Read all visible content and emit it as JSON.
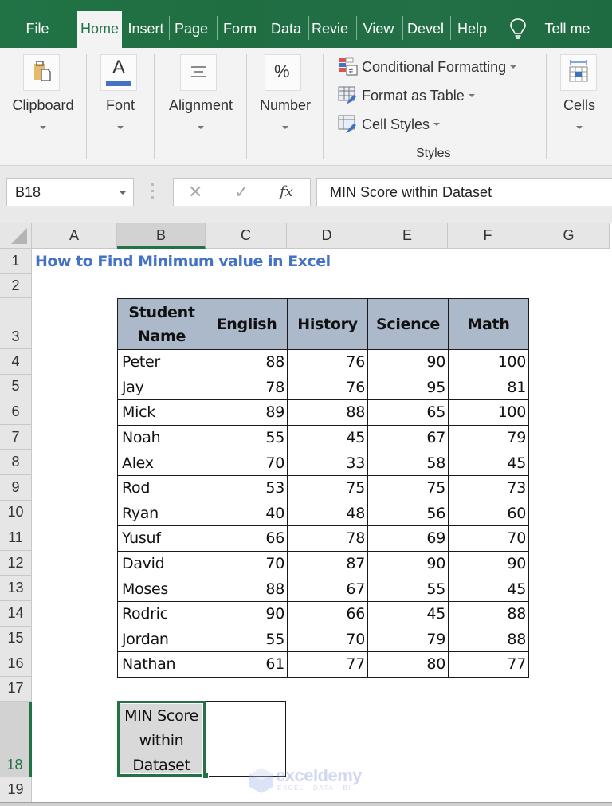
{
  "tabs": [
    {
      "id": "file",
      "label": "File"
    },
    {
      "id": "home",
      "label": "Home",
      "active": true
    },
    {
      "id": "insert",
      "label": "Insert"
    },
    {
      "id": "page",
      "label": "Page"
    },
    {
      "id": "form",
      "label": "Form"
    },
    {
      "id": "data",
      "label": "Data"
    },
    {
      "id": "review",
      "label": "Revie"
    },
    {
      "id": "view",
      "label": "View"
    },
    {
      "id": "devel",
      "label": "Devel"
    },
    {
      "id": "help",
      "label": "Help"
    },
    {
      "id": "tellme",
      "label": "Tell me"
    }
  ],
  "ribbon": {
    "clipboard": "Clipboard",
    "font": "Font",
    "alignment": "Alignment",
    "number": "Number",
    "number_icon": "%",
    "font_icon": "A",
    "styles": {
      "conditional_formatting": "Conditional Formatting",
      "format_as_table": "Format as Table",
      "cell_styles": "Cell Styles",
      "group_label": "Styles"
    },
    "cells": "Cells"
  },
  "formula_bar": {
    "name_box": "B18",
    "cancel_icon": "✕",
    "enter_icon": "✓",
    "fx_label": "fx",
    "formula": "MIN Score within Dataset"
  },
  "columns": [
    "A",
    "B",
    "C",
    "D",
    "E",
    "F",
    "G"
  ],
  "selected_column": "B",
  "rows": [
    "1",
    "2",
    "3",
    "4",
    "5",
    "6",
    "7",
    "8",
    "9",
    "10",
    "11",
    "12",
    "13",
    "14",
    "15",
    "16",
    "17",
    "18",
    "19"
  ],
  "selected_row": "18",
  "sheet": {
    "title": "How to Find Minimum value in Excel",
    "table": {
      "headers": [
        "Student Name",
        "English",
        "History",
        "Science",
        "Math"
      ],
      "header_lines": [
        [
          "Student",
          "Name"
        ],
        [
          "English"
        ],
        [
          "History"
        ],
        [
          "Science"
        ],
        [
          "Math"
        ]
      ],
      "rows": [
        {
          "name": "Peter",
          "values": [
            88,
            76,
            90,
            100
          ]
        },
        {
          "name": "Jay",
          "values": [
            78,
            76,
            95,
            81
          ]
        },
        {
          "name": "Mick",
          "values": [
            89,
            88,
            65,
            100
          ]
        },
        {
          "name": "Noah",
          "values": [
            55,
            45,
            67,
            79
          ]
        },
        {
          "name": "Alex",
          "values": [
            70,
            33,
            58,
            45
          ]
        },
        {
          "name": "Rod",
          "values": [
            53,
            75,
            75,
            73
          ]
        },
        {
          "name": "Ryan",
          "values": [
            40,
            48,
            56,
            60
          ]
        },
        {
          "name": "Yusuf",
          "values": [
            66,
            78,
            69,
            70
          ]
        },
        {
          "name": "David",
          "values": [
            70,
            87,
            90,
            90
          ]
        },
        {
          "name": "Moses",
          "values": [
            88,
            67,
            55,
            45
          ]
        },
        {
          "name": "Rodric",
          "values": [
            90,
            66,
            45,
            88
          ]
        },
        {
          "name": "Jordan",
          "values": [
            55,
            70,
            79,
            88
          ]
        },
        {
          "name": "Nathan",
          "values": [
            61,
            77,
            80,
            77
          ]
        }
      ]
    },
    "min_label_lines": [
      "MIN Score",
      "within",
      "Dataset"
    ],
    "min_value": ""
  },
  "watermark": {
    "name": "exceldemy",
    "tagline": "EXCEL · DATA · BI"
  },
  "colors": {
    "accent": "#217346",
    "title_blue": "#4472c4",
    "table_header": "#acb9ca",
    "selected_cell_fill": "#d9d9d9"
  }
}
